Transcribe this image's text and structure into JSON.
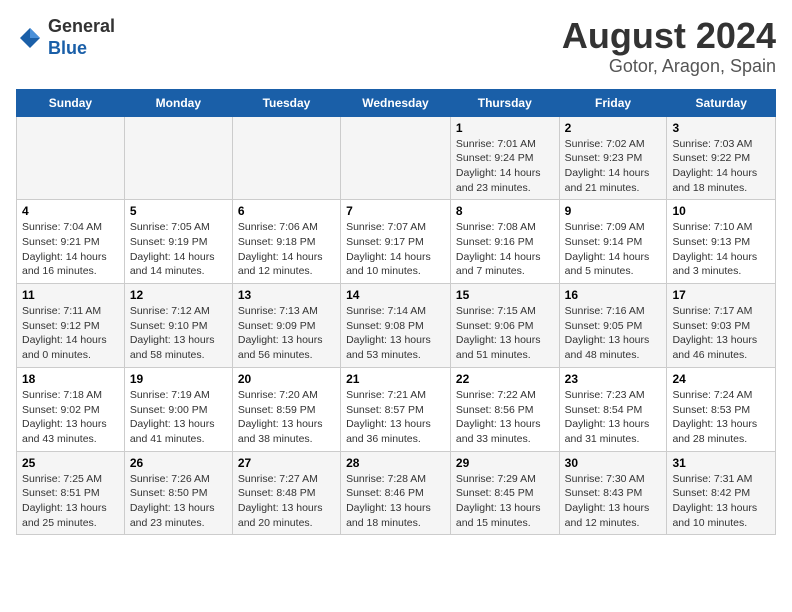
{
  "logo": {
    "general": "General",
    "blue": "Blue"
  },
  "title": "August 2024",
  "subtitle": "Gotor, Aragon, Spain",
  "days_of_week": [
    "Sunday",
    "Monday",
    "Tuesday",
    "Wednesday",
    "Thursday",
    "Friday",
    "Saturday"
  ],
  "weeks": [
    [
      {
        "day": "",
        "info": ""
      },
      {
        "day": "",
        "info": ""
      },
      {
        "day": "",
        "info": ""
      },
      {
        "day": "",
        "info": ""
      },
      {
        "day": "1",
        "info": "Sunrise: 7:01 AM\nSunset: 9:24 PM\nDaylight: 14 hours\nand 23 minutes."
      },
      {
        "day": "2",
        "info": "Sunrise: 7:02 AM\nSunset: 9:23 PM\nDaylight: 14 hours\nand 21 minutes."
      },
      {
        "day": "3",
        "info": "Sunrise: 7:03 AM\nSunset: 9:22 PM\nDaylight: 14 hours\nand 18 minutes."
      }
    ],
    [
      {
        "day": "4",
        "info": "Sunrise: 7:04 AM\nSunset: 9:21 PM\nDaylight: 14 hours\nand 16 minutes."
      },
      {
        "day": "5",
        "info": "Sunrise: 7:05 AM\nSunset: 9:19 PM\nDaylight: 14 hours\nand 14 minutes."
      },
      {
        "day": "6",
        "info": "Sunrise: 7:06 AM\nSunset: 9:18 PM\nDaylight: 14 hours\nand 12 minutes."
      },
      {
        "day": "7",
        "info": "Sunrise: 7:07 AM\nSunset: 9:17 PM\nDaylight: 14 hours\nand 10 minutes."
      },
      {
        "day": "8",
        "info": "Sunrise: 7:08 AM\nSunset: 9:16 PM\nDaylight: 14 hours\nand 7 minutes."
      },
      {
        "day": "9",
        "info": "Sunrise: 7:09 AM\nSunset: 9:14 PM\nDaylight: 14 hours\nand 5 minutes."
      },
      {
        "day": "10",
        "info": "Sunrise: 7:10 AM\nSunset: 9:13 PM\nDaylight: 14 hours\nand 3 minutes."
      }
    ],
    [
      {
        "day": "11",
        "info": "Sunrise: 7:11 AM\nSunset: 9:12 PM\nDaylight: 14 hours\nand 0 minutes."
      },
      {
        "day": "12",
        "info": "Sunrise: 7:12 AM\nSunset: 9:10 PM\nDaylight: 13 hours\nand 58 minutes."
      },
      {
        "day": "13",
        "info": "Sunrise: 7:13 AM\nSunset: 9:09 PM\nDaylight: 13 hours\nand 56 minutes."
      },
      {
        "day": "14",
        "info": "Sunrise: 7:14 AM\nSunset: 9:08 PM\nDaylight: 13 hours\nand 53 minutes."
      },
      {
        "day": "15",
        "info": "Sunrise: 7:15 AM\nSunset: 9:06 PM\nDaylight: 13 hours\nand 51 minutes."
      },
      {
        "day": "16",
        "info": "Sunrise: 7:16 AM\nSunset: 9:05 PM\nDaylight: 13 hours\nand 48 minutes."
      },
      {
        "day": "17",
        "info": "Sunrise: 7:17 AM\nSunset: 9:03 PM\nDaylight: 13 hours\nand 46 minutes."
      }
    ],
    [
      {
        "day": "18",
        "info": "Sunrise: 7:18 AM\nSunset: 9:02 PM\nDaylight: 13 hours\nand 43 minutes."
      },
      {
        "day": "19",
        "info": "Sunrise: 7:19 AM\nSunset: 9:00 PM\nDaylight: 13 hours\nand 41 minutes."
      },
      {
        "day": "20",
        "info": "Sunrise: 7:20 AM\nSunset: 8:59 PM\nDaylight: 13 hours\nand 38 minutes."
      },
      {
        "day": "21",
        "info": "Sunrise: 7:21 AM\nSunset: 8:57 PM\nDaylight: 13 hours\nand 36 minutes."
      },
      {
        "day": "22",
        "info": "Sunrise: 7:22 AM\nSunset: 8:56 PM\nDaylight: 13 hours\nand 33 minutes."
      },
      {
        "day": "23",
        "info": "Sunrise: 7:23 AM\nSunset: 8:54 PM\nDaylight: 13 hours\nand 31 minutes."
      },
      {
        "day": "24",
        "info": "Sunrise: 7:24 AM\nSunset: 8:53 PM\nDaylight: 13 hours\nand 28 minutes."
      }
    ],
    [
      {
        "day": "25",
        "info": "Sunrise: 7:25 AM\nSunset: 8:51 PM\nDaylight: 13 hours\nand 25 minutes."
      },
      {
        "day": "26",
        "info": "Sunrise: 7:26 AM\nSunset: 8:50 PM\nDaylight: 13 hours\nand 23 minutes."
      },
      {
        "day": "27",
        "info": "Sunrise: 7:27 AM\nSunset: 8:48 PM\nDaylight: 13 hours\nand 20 minutes."
      },
      {
        "day": "28",
        "info": "Sunrise: 7:28 AM\nSunset: 8:46 PM\nDaylight: 13 hours\nand 18 minutes."
      },
      {
        "day": "29",
        "info": "Sunrise: 7:29 AM\nSunset: 8:45 PM\nDaylight: 13 hours\nand 15 minutes."
      },
      {
        "day": "30",
        "info": "Sunrise: 7:30 AM\nSunset: 8:43 PM\nDaylight: 13 hours\nand 12 minutes."
      },
      {
        "day": "31",
        "info": "Sunrise: 7:31 AM\nSunset: 8:42 PM\nDaylight: 13 hours\nand 10 minutes."
      }
    ]
  ]
}
